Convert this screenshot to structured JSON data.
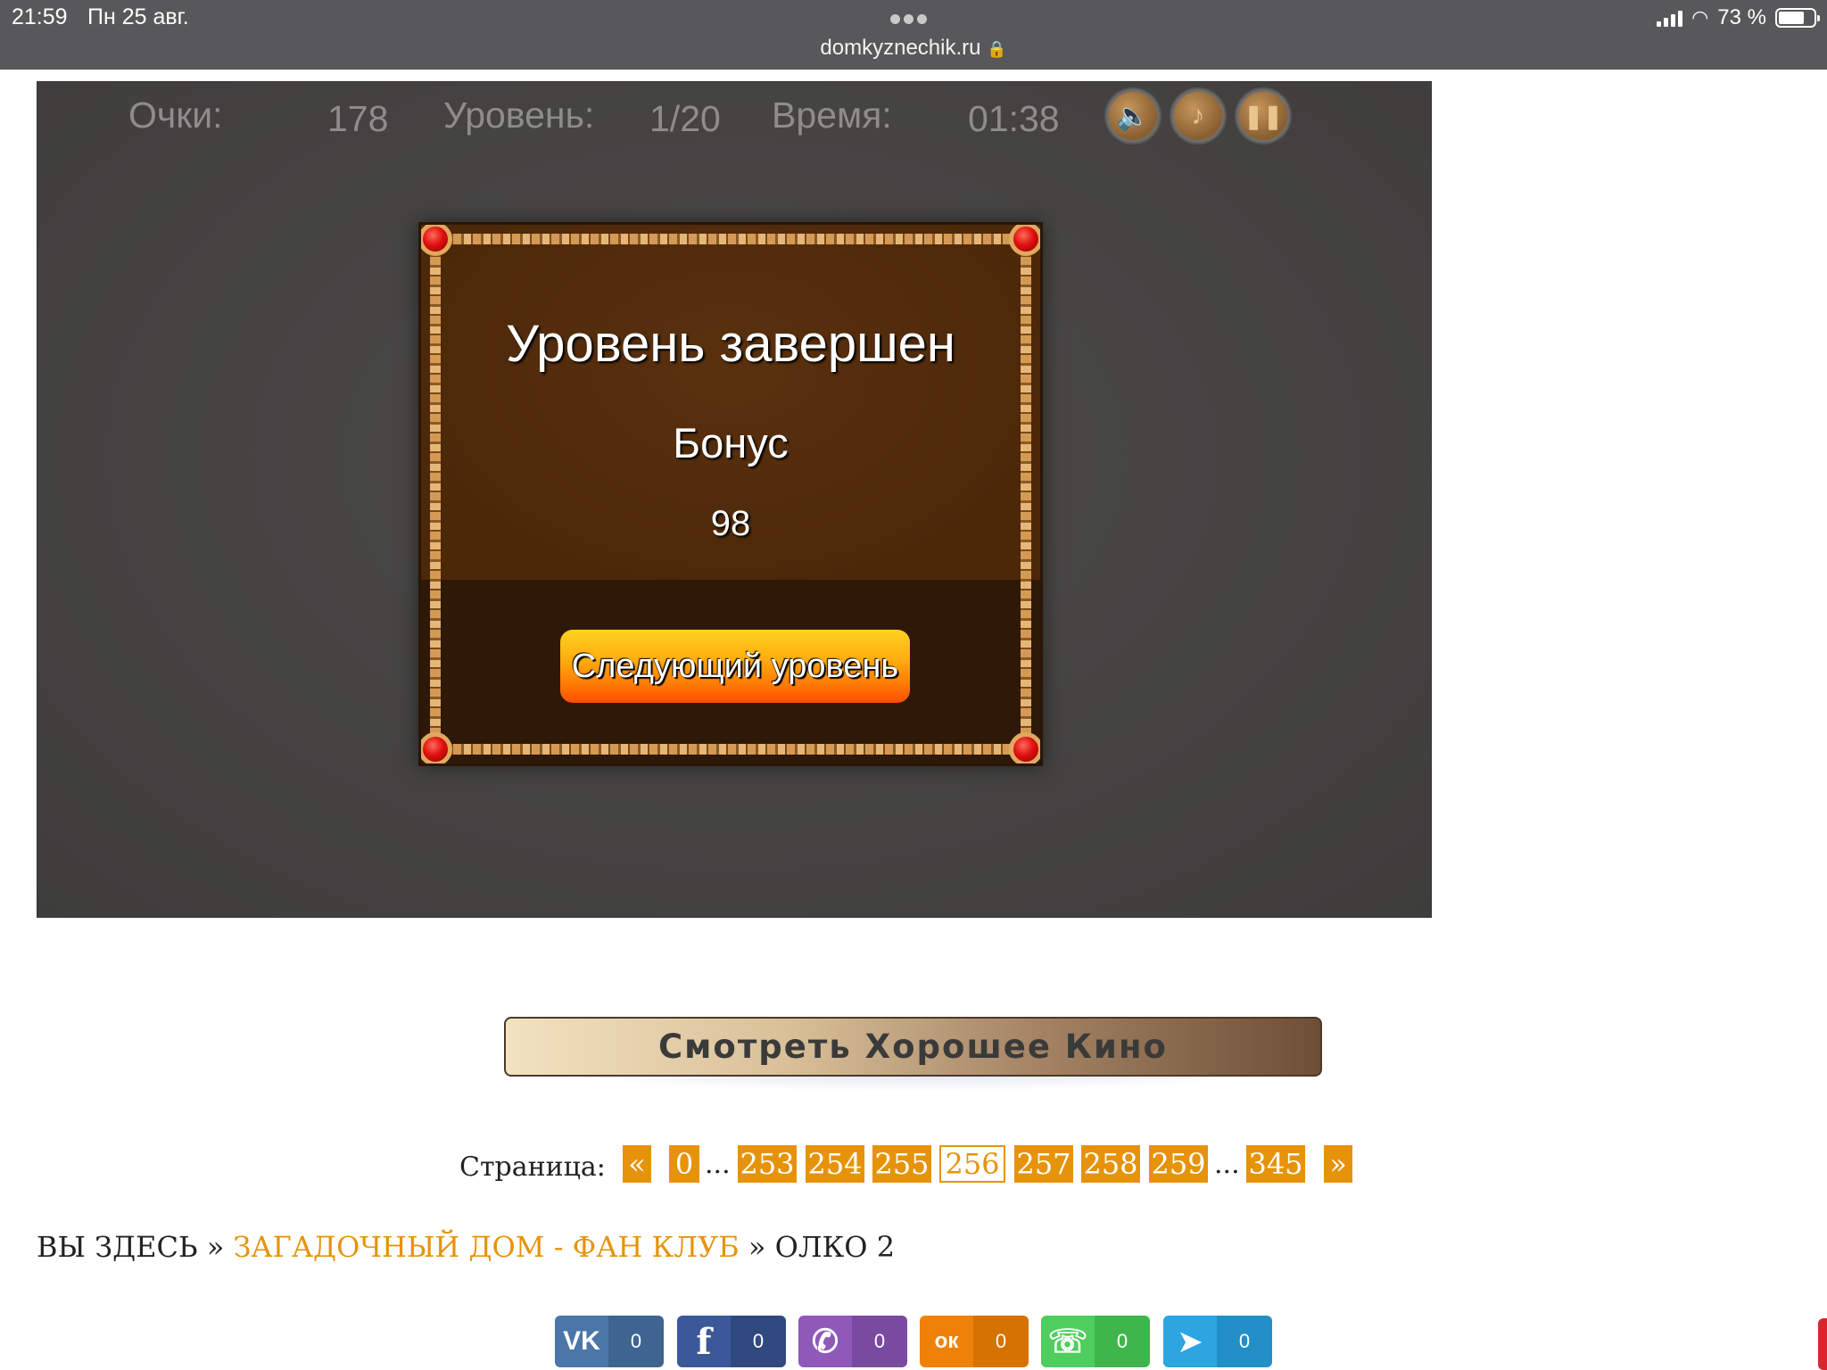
{
  "status_bar": {
    "time": "21:59",
    "date": "Пн 25 авг.",
    "url": "domkyznechik.ru",
    "battery": "73 %",
    "battery_level": 0.73
  },
  "game": {
    "hud": {
      "score_label": "Очки:",
      "score_value": "178",
      "level_label": "Уровень:",
      "level_value": "1/20",
      "time_label": "Время:",
      "time_value": "01:38",
      "buttons": [
        "sound-icon",
        "music-icon",
        "pause-icon"
      ]
    },
    "dialog": {
      "title": "Уровень завершен",
      "bonus_label": "Бонус",
      "bonus_value": "98",
      "next_button": "Следующий уровень"
    }
  },
  "banner": {
    "label": "Смотреть Хорошее Кино"
  },
  "pagination": {
    "label": "Страница:",
    "prev": "«",
    "next": "»",
    "ellipsis": "...",
    "pages": [
      "0",
      "253",
      "254",
      "255",
      "256",
      "257",
      "258",
      "259",
      "345"
    ],
    "current": "256"
  },
  "breadcrumb": {
    "prefix": "ВЫ ЗДЕСЬ",
    "sep": "»",
    "link": "ЗАГАДОЧНЫЙ ДОМ - ФАН КЛУБ",
    "current": "ОЛКО 2"
  },
  "share": [
    {
      "network": "vk",
      "icon": "vk-icon",
      "glyph": "VK",
      "count": "0",
      "color": "#4a76a8",
      "dark": "#3d6590"
    },
    {
      "network": "facebook",
      "icon": "facebook-icon",
      "glyph": "f",
      "count": "0",
      "color": "#3b5998",
      "dark": "#30497e"
    },
    {
      "network": "viber",
      "icon": "viber-icon",
      "glyph": "✆",
      "count": "0",
      "color": "#8e59b8",
      "dark": "#7a4aa0"
    },
    {
      "network": "odnoklassniki",
      "icon": "odnoklassniki-icon",
      "glyph": "ок",
      "count": "0",
      "color": "#ee8208",
      "dark": "#d67200"
    },
    {
      "network": "whatsapp",
      "icon": "whatsapp-icon",
      "glyph": "☏",
      "count": "0",
      "color": "#4fce5d",
      "dark": "#3fb64c"
    },
    {
      "network": "telegram",
      "icon": "telegram-icon",
      "glyph": "➤",
      "count": "0",
      "color": "#2ca5e0",
      "dark": "#2290c6"
    }
  ]
}
